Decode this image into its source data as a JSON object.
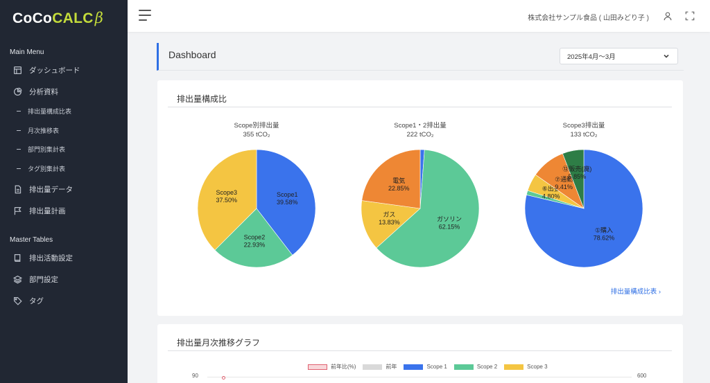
{
  "brand": {
    "part1": "CoCo",
    "part2": "CALC",
    "part3": "β"
  },
  "sidebar": {
    "main_menu_label": "Main Menu",
    "master_tables_label": "Master Tables",
    "items": [
      {
        "label": "ダッシュボード",
        "icon": "layout-icon"
      },
      {
        "label": "分析資料",
        "icon": "pie-chart-icon"
      },
      {
        "label": "排出量データ",
        "icon": "file-icon"
      },
      {
        "label": "排出量計画",
        "icon": "flag-icon"
      }
    ],
    "sub_items": [
      "排出量構成比表",
      "月次推移表",
      "部門別集計表",
      "タグ別集計表"
    ],
    "master_items": [
      {
        "label": "排出活動設定",
        "icon": "book-icon"
      },
      {
        "label": "部門設定",
        "icon": "layers-icon"
      },
      {
        "label": "タグ",
        "icon": "tag-icon"
      }
    ]
  },
  "topbar": {
    "company": "株式会社サンプル食品 ( 山田みどり子 )"
  },
  "dashboard": {
    "title": "Dashboard",
    "period": "2025年4月〜3月"
  },
  "composition_card": {
    "title": "排出量構成比",
    "link": "排出量構成比表 ›"
  },
  "monthly_card": {
    "title": "排出量月次推移グラフ"
  },
  "colors": {
    "scope1": "#3a73ec",
    "scope2": "#5cc997",
    "scope3": "#f4c542",
    "orange": "#ee8734",
    "green_dark": "#2e7d46",
    "accent": "#2f6fe4",
    "sidebar_bg": "#212733"
  },
  "chart_data": [
    {
      "type": "pie",
      "title": "Scope別排出量",
      "subtitle": "355 tCO₂",
      "slices": [
        {
          "label": "Scope1",
          "value": 39.58,
          "display": "39.58%",
          "color": "#3a73ec"
        },
        {
          "label": "Scope2",
          "value": 22.93,
          "display": "22.93%",
          "color": "#5cc997"
        },
        {
          "label": "Scope3",
          "value": 37.5,
          "display": "37.50%",
          "color": "#f4c542"
        }
      ]
    },
    {
      "type": "pie",
      "title": "Scope1・2排出量",
      "subtitle": "222 tCO₂",
      "slices": [
        {
          "label": "",
          "value": 1.17,
          "display": "",
          "color": "#3a73ec"
        },
        {
          "label": "ガソリン",
          "value": 62.15,
          "display": "62.15%",
          "color": "#5cc997"
        },
        {
          "label": "ガス",
          "value": 13.83,
          "display": "13.83%",
          "color": "#f4c542"
        },
        {
          "label": "電気",
          "value": 22.85,
          "display": "22.85%",
          "color": "#ee8734"
        }
      ]
    },
    {
      "type": "pie",
      "title": "Scope3排出量",
      "subtitle": "133 tCO₂",
      "slices": [
        {
          "label": "①購入",
          "value": 78.62,
          "display": "78.62%",
          "color": "#3a73ec"
        },
        {
          "label": "",
          "value": 1.2,
          "display": "",
          "color": "#5cc997"
        },
        {
          "label": "⑥出張",
          "value": 4.8,
          "display": "4.80%",
          "color": "#f4c542"
        },
        {
          "label": "⑦通勤",
          "value": 9.41,
          "display": "9.41%",
          "color": "#ee8734"
        },
        {
          "label": "⑫販売(廃)",
          "value": 5.85,
          "display": "5.85%",
          "color": "#2e7d46"
        }
      ]
    },
    {
      "type": "bar",
      "legend": [
        {
          "name": "前年比(%)",
          "color": "#f8d7da"
        },
        {
          "name": "前年",
          "color": "#d9d9d9"
        },
        {
          "name": "Scope 1",
          "color": "#3a73ec"
        },
        {
          "name": "Scope 2",
          "color": "#5cc997"
        },
        {
          "name": "Scope 3",
          "color": "#f4c542"
        }
      ],
      "y_left_max": "90",
      "y_right_max": "600"
    }
  ]
}
